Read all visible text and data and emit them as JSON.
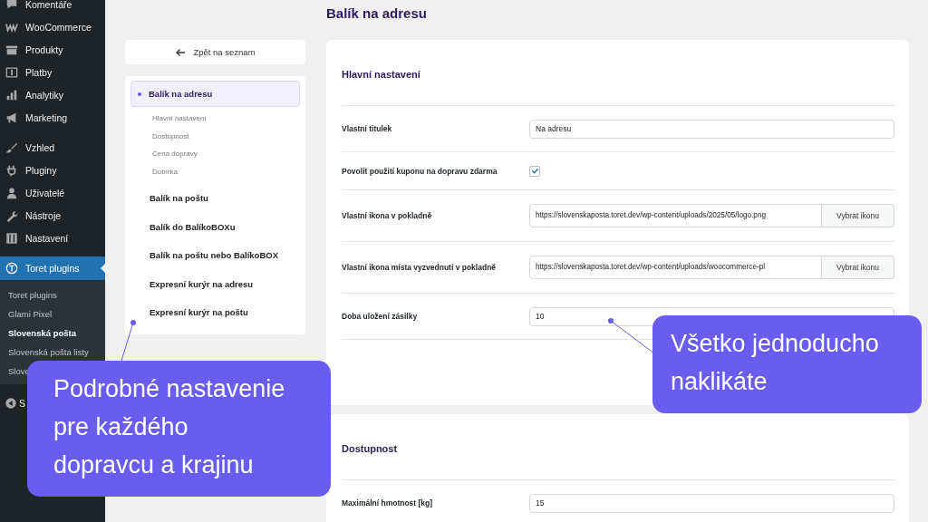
{
  "sidebar": {
    "items": [
      {
        "label": "Komentáře",
        "selected": false
      },
      {
        "label": "WooCommerce",
        "selected": false
      },
      {
        "label": "Produkty",
        "selected": false
      },
      {
        "label": "Platby",
        "selected": false
      },
      {
        "label": "Analytiky",
        "selected": false
      },
      {
        "label": "Marketing",
        "selected": false
      },
      {
        "label": "Vzhled",
        "selected": false
      },
      {
        "label": "Pluginy",
        "selected": false
      },
      {
        "label": "Uživatelé",
        "selected": false
      },
      {
        "label": "Nástroje",
        "selected": false
      },
      {
        "label": "Nastavení",
        "selected": false
      },
      {
        "label": "Toret plugins",
        "selected": true,
        "children": [
          {
            "label": "Toret plugins",
            "selected": false
          },
          {
            "label": "Glami Pixel",
            "selected": false
          },
          {
            "label": "Slovenská pošta",
            "selected": true
          },
          {
            "label": "Slovenská pošta listy",
            "selected": false
          },
          {
            "label": "Slove",
            "selected": false
          }
        ]
      },
      {
        "label": "S",
        "selected": false
      }
    ]
  },
  "page_title": "Balík na adresu",
  "back_button": "Zpět na seznam",
  "nav": [
    {
      "label": "Balík na adresu",
      "selected": true,
      "children": [
        {
          "label": "Hlavní nastavení"
        },
        {
          "label": "Dostupnost"
        },
        {
          "label": "Cena dopravy"
        },
        {
          "label": "Dobírka"
        }
      ]
    },
    {
      "label": "Balík na poštu",
      "selected": false
    },
    {
      "label": "Balík do BalíkoBOXu",
      "selected": false
    },
    {
      "label": "Balík na poštu nebo BalíkoBOX",
      "selected": false
    },
    {
      "label": "Expresní kurýr na adresu",
      "selected": false
    },
    {
      "label": "Expresní kurýr na poštu",
      "selected": false
    }
  ],
  "sections": [
    {
      "title": "Hlavní nastavení",
      "rows": [
        {
          "kind": "text",
          "label": "Vlastní titulek",
          "value": "Na adresu"
        },
        {
          "kind": "checkbox",
          "label": "Povolit použití kuponu na dopravu zdarma",
          "checked": true
        },
        {
          "kind": "file",
          "label": "Vlastní ikona v pokladně",
          "value": "https://slovenskaposta.toret.dev/wp-content/uploads/2025/05/logo.png",
          "button": "Vybrat ikonu"
        },
        {
          "kind": "file",
          "label": "Vlastní ikona místa vyzvednutí v pokladně",
          "value": "https://slovenskaposta.toret.dev/wp-content/uploads/woocommerce-pl",
          "button": "Vybrat ikonu"
        },
        {
          "kind": "text",
          "label": "Doba uložení zásilky",
          "value": "10"
        }
      ]
    },
    {
      "title": "Dostupnost",
      "rows": [
        {
          "kind": "text",
          "label": "Maximální hmotnost [kg]",
          "value": "15"
        }
      ]
    }
  ],
  "callouts": [
    {
      "text": "Podrobné nastavenie pre každého dopravcu a krajinu"
    },
    {
      "text": "Všetko jednoducho naklikáte"
    }
  ]
}
